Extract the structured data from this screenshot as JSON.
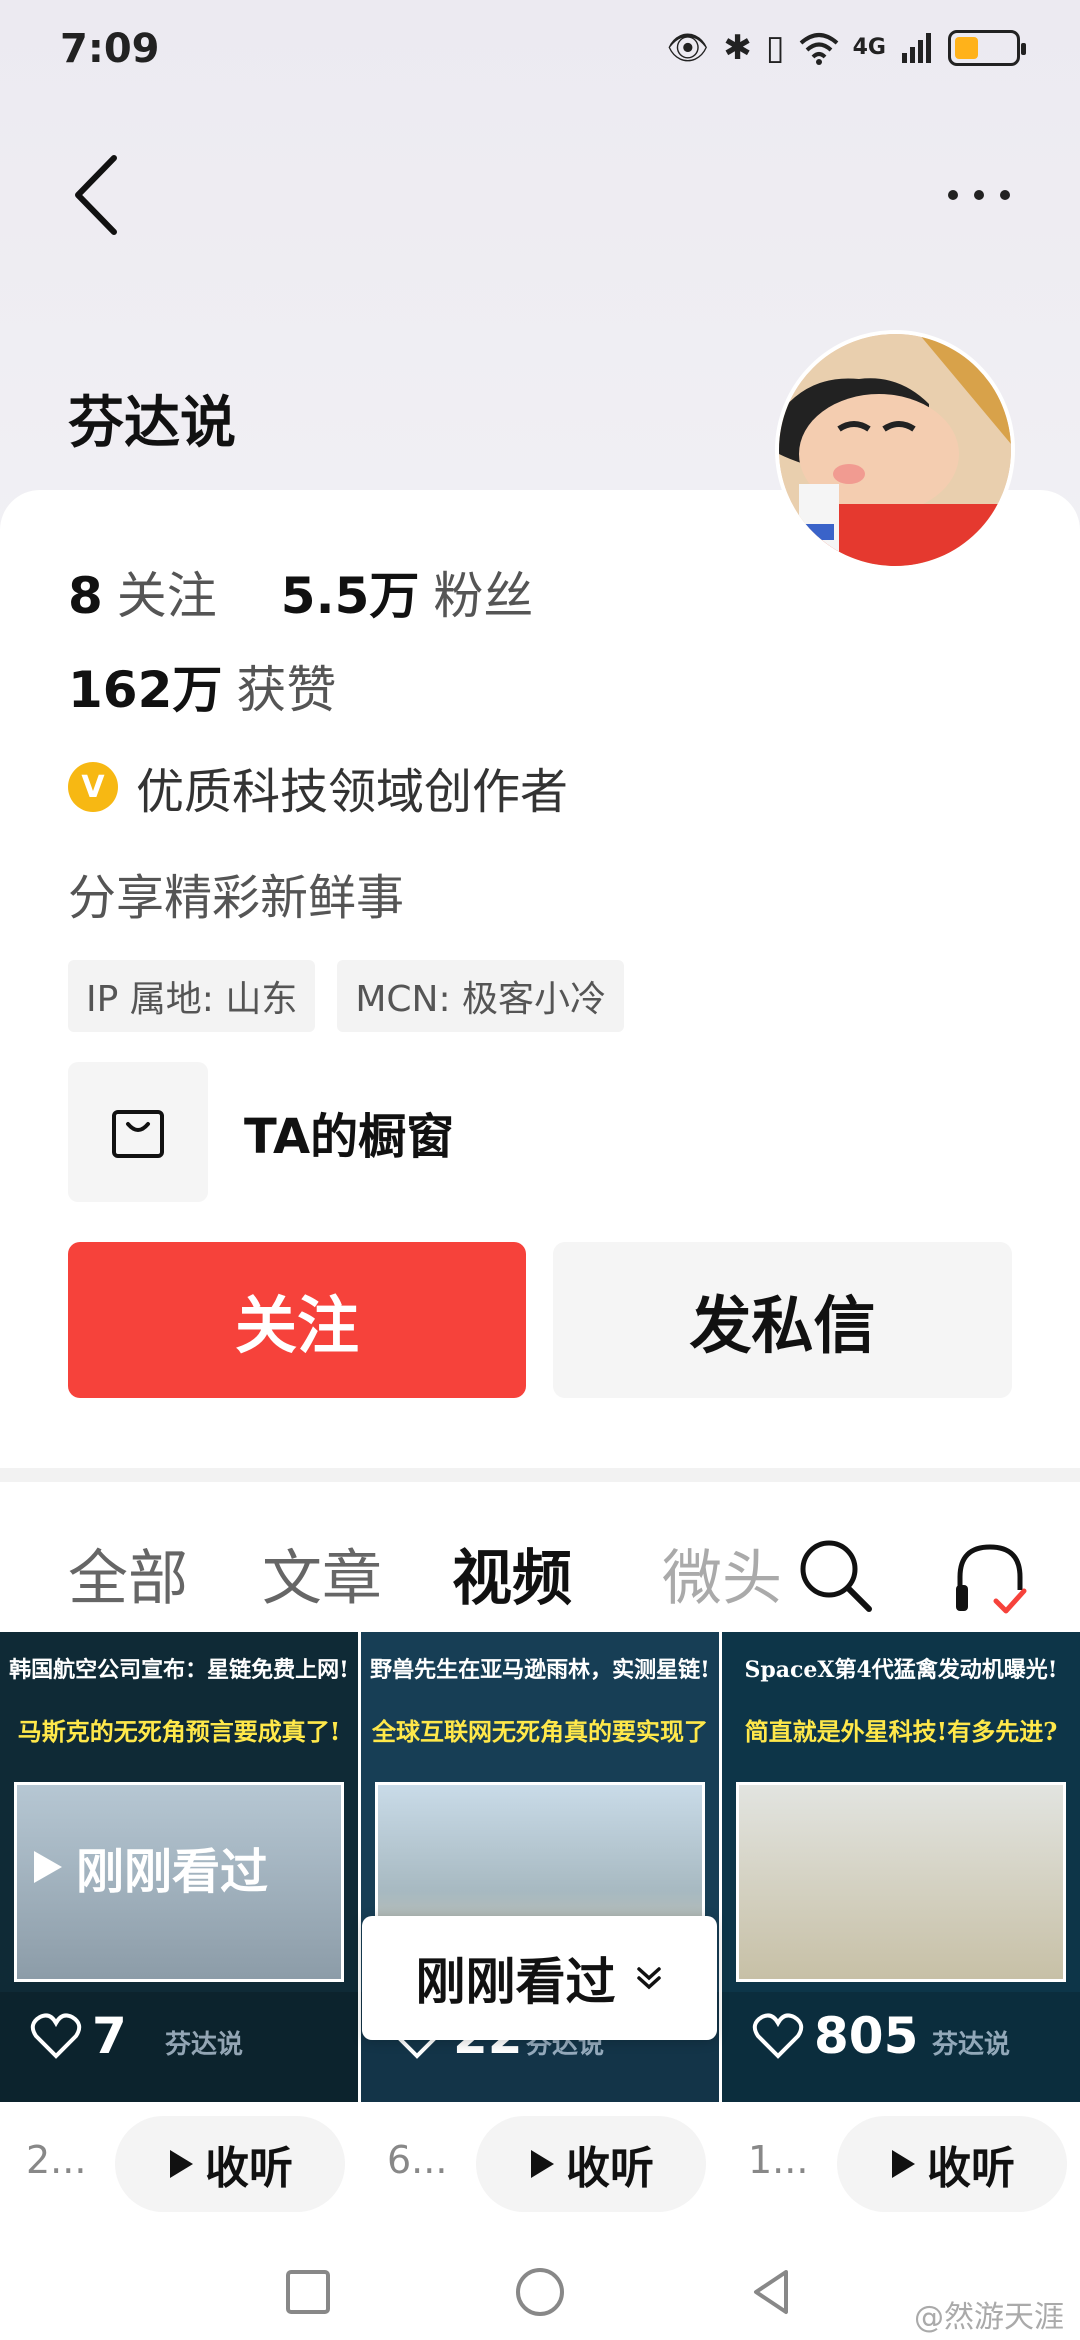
{
  "status_bar": {
    "time": "7:09",
    "network": "4G"
  },
  "profile": {
    "name": "芬达说",
    "following_count": "8",
    "following_label": "关注",
    "followers_count": "5.5万",
    "followers_label": "粉丝",
    "likes_count": "162万",
    "likes_label": "获赞",
    "verify_badge": "V",
    "verify_text": "优质科技领域创作者",
    "bio": "分享精彩新鲜事",
    "tags": [
      "IP 属地: 山东",
      "MCN: 极客小冷"
    ],
    "shop_label": "TA的橱窗"
  },
  "actions": {
    "follow": "关注",
    "message": "发私信"
  },
  "tabs": [
    "全部",
    "文章",
    "视频",
    "微头"
  ],
  "active_tab": "视频",
  "videos": [
    {
      "headline": "韩国航空公司宣布：星链免费上网!",
      "subtitle": "马斯克的无死角预言要成真了!",
      "likes": "7",
      "author": "芬达说",
      "overlay": "刚刚看过",
      "desc": "2...",
      "listen": "收听"
    },
    {
      "headline": "野兽先生在亚马逊雨林，实测星链!",
      "subtitle": "全球互联网无死角真的要实现了",
      "likes": "22",
      "author": "芬达说",
      "desc": "6...",
      "listen": "收听"
    },
    {
      "headline": "SpaceX第4代猛禽发动机曝光!",
      "subtitle": "简直就是外星科技!有多先进?",
      "likes": "805",
      "author": "芬达说",
      "desc": "1...",
      "listen": "收听"
    }
  ],
  "recent_popup": "刚刚看过",
  "watermark": "@然游天涯",
  "colors": {
    "accent": "#f6423b",
    "badge": "#f7b813"
  }
}
